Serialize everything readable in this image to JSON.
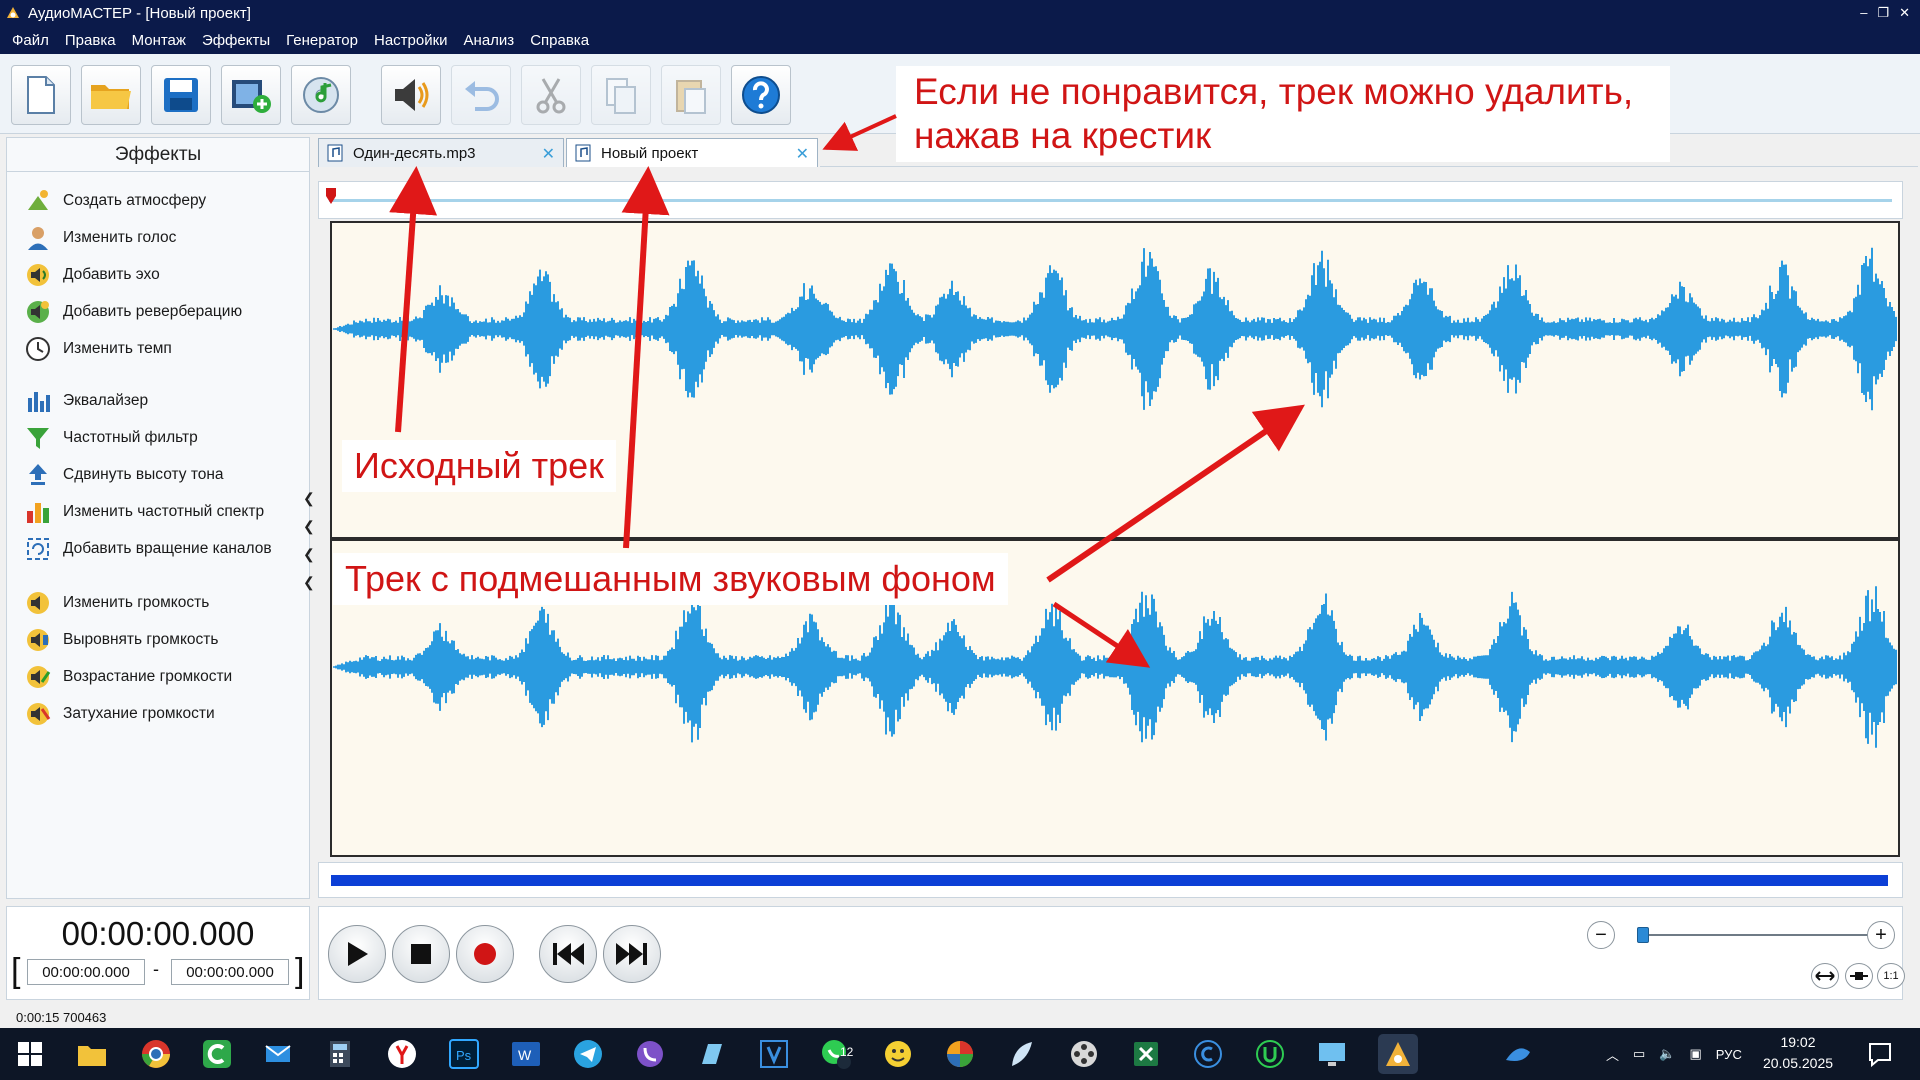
{
  "window": {
    "title": "АудиоМАСТЕР - [Новый проект]",
    "controls": [
      "–",
      "❐",
      "✕"
    ]
  },
  "menu": [
    "Файл",
    "Правка",
    "Монтаж",
    "Эффекты",
    "Генератор",
    "Настройки",
    "Анализ",
    "Справка"
  ],
  "toolbar": {
    "buttons": [
      "new-file",
      "open-folder",
      "save",
      "add-video",
      "add-music",
      "add-effect",
      "undo",
      "cut",
      "copy",
      "paste",
      "help"
    ]
  },
  "effects_panel": {
    "title": "Эффекты",
    "items": [
      {
        "label": "Создать атмосферу",
        "icon": "atmosphere-icon"
      },
      {
        "label": "Изменить голос",
        "icon": "voice-icon"
      },
      {
        "label": "Добавить эхо",
        "icon": "echo-icon"
      },
      {
        "label": "Добавить реверберацию",
        "icon": "reverb-icon"
      },
      {
        "label": "Изменить темп",
        "icon": "tempo-clock-icon"
      },
      {
        "label": "Эквалайзер",
        "icon": "equalizer-icon"
      },
      {
        "label": "Частотный фильтр",
        "icon": "funnel-icon"
      },
      {
        "label": "Сдвинуть высоту тона",
        "icon": "pitch-arrow-icon"
      },
      {
        "label": "Изменить частотный спектр",
        "icon": "spectrum-icon"
      },
      {
        "label": "Добавить вращение каналов",
        "icon": "rotate-channels-icon"
      },
      {
        "label": "Изменить громкость",
        "icon": "volume-icon"
      },
      {
        "label": "Выровнять громкость",
        "icon": "normalize-icon"
      },
      {
        "label": "Возрастание громкости",
        "icon": "fade-in-icon"
      },
      {
        "label": "Затухание громкости",
        "icon": "fade-out-icon"
      }
    ]
  },
  "tabs": [
    {
      "label": "Один-десять.mp3",
      "active": false
    },
    {
      "label": "Новый проект",
      "active": true
    }
  ],
  "timeline": {
    "current_time": "00:00:00.000",
    "selection_start": "00:00:00.000",
    "selection_dash": "-",
    "selection_end": "00:00:00.000",
    "bracket_open": "[",
    "bracket_close": "]"
  },
  "zoom": {
    "minus": "−",
    "plus": "+",
    "fit_label": "1:1"
  },
  "status": "0:00:15 700463",
  "annotations": {
    "delete_hint": "Если не понравится, трек можно удалить, нажав на крестик",
    "source_track": "Исходный трек",
    "mixed_track": "Трек с подмешанным звуковым фоном"
  },
  "taskbar": {
    "apps": [
      "windows-start",
      "file-explorer",
      "chrome",
      "green-c-app",
      "outlook",
      "calculator",
      "yandex-browser",
      "photoshop",
      "word",
      "telegram",
      "viber",
      "stencil-app",
      "visio-v",
      "whatsapp",
      "emoji-app",
      "colorful-app",
      "feather-app",
      "film-reel",
      "excel",
      "c-circle-app",
      "u-circle-app",
      "monitor-app",
      "audiomaster"
    ],
    "whatsapp_badge": "12",
    "language": "РУС",
    "time": "19:02",
    "date": "20.05.2025"
  },
  "colors": {
    "title_bg": "#0b1a4a",
    "wave": "#2a9be0",
    "track_bg": "#fdf9ee",
    "annotation": "#d01515",
    "scroll": "#0c3fd6"
  }
}
